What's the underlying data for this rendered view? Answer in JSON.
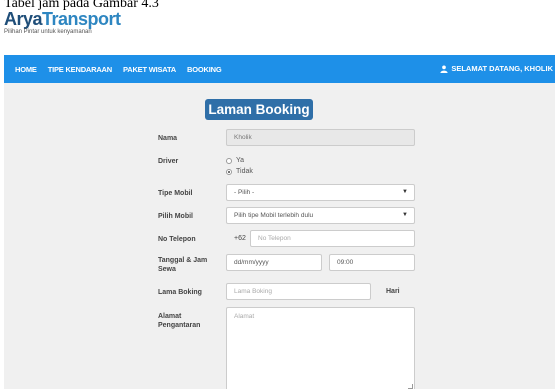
{
  "caption": "Tabel jam pada Gambar 4.3",
  "brand": {
    "part1": "Arya",
    "part2": "Transport",
    "tagline": "Pilihan Pintar untuk kenyamanan"
  },
  "nav": {
    "items": [
      "HOME",
      "TIPE KENDARAAN",
      "PAKET WISATA",
      "BOOKING"
    ],
    "greeting": "SELAMAT DATANG, KHOLIK"
  },
  "form": {
    "title": "Laman Booking",
    "nama_label": "Nama",
    "nama_value": "Kholik",
    "driver_label": "Driver",
    "driver_options": [
      "Ya",
      "Tidak"
    ],
    "driver_selected": "Tidak",
    "tipe_label": "Tipe Mobil",
    "tipe_value": "- Pilih -",
    "pilih_label": "Pilih Mobil",
    "pilih_value": "Pilih tipe Mobil terlebih dulu",
    "telepon_label": "No Telepon",
    "telepon_prefix": "+62",
    "telepon_placeholder": "No Telepon",
    "tanggal_label": "Tanggal & Jam Sewa",
    "tanggal_value": "dd/mm/yyyy",
    "jam_value": "09:00",
    "lama_label": "Lama Boking",
    "lama_placeholder": "Lama Boking",
    "hari_label": "Hari",
    "alamat_label": "Alamat Pengantaran",
    "alamat_placeholder": "Alamat"
  },
  "colors": {
    "navbar": "#1e90e8",
    "title_box": "#2f6fa8"
  }
}
